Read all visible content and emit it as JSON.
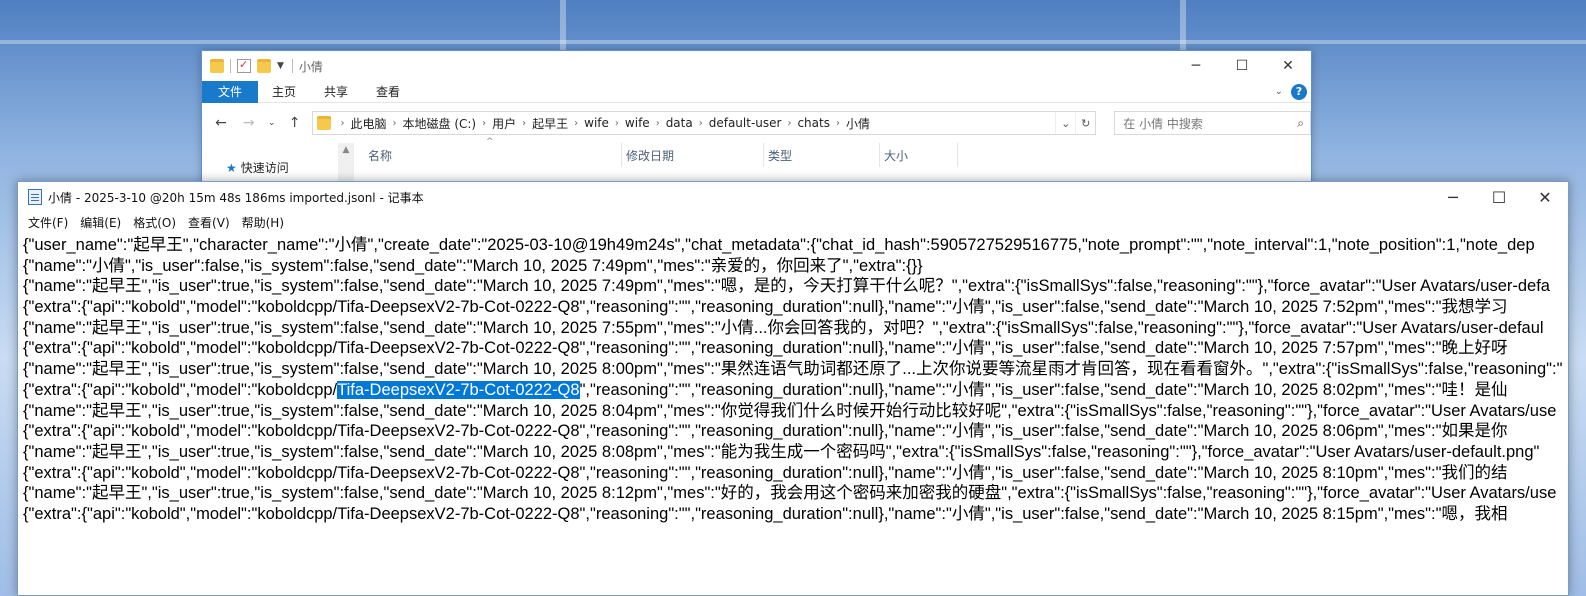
{
  "explorer": {
    "title": "小倩",
    "ribbon_tabs": [
      "文件",
      "主页",
      "共享",
      "查看"
    ],
    "breadcrumbs": [
      "此电脑",
      "本地磁盘 (C:)",
      "用户",
      "起早王",
      "wife",
      "wife",
      "data",
      "default-user",
      "chats",
      "小倩"
    ],
    "search_placeholder": "在 小倩 中搜索",
    "nav_quick_access": "快速访问",
    "columns": [
      "名称",
      "修改日期",
      "类型",
      "大小"
    ]
  },
  "notepad": {
    "title": "小倩 - 2025-3-10 @20h 15m 48s 186ms imported.jsonl - 记事本",
    "menu": [
      "文件(F)",
      "编辑(E)",
      "格式(O)",
      "查看(V)",
      "帮助(H)"
    ],
    "selected_text": "Tifa-DeepsexV2-7b-Cot-0222-Q8",
    "lines": [
      "{\"user_name\":\"起早王\",\"character_name\":\"小倩\",\"create_date\":\"2025-03-10@19h49m24s\",\"chat_metadata\":{\"chat_id_hash\":5905727529516775,\"note_prompt\":\"\",\"note_interval\":1,\"note_position\":1,\"note_dep",
      "{\"name\":\"小倩\",\"is_user\":false,\"is_system\":false,\"send_date\":\"March 10, 2025 7:49pm\",\"mes\":\"亲爱的，你回来了\",\"extra\":{}}",
      "{\"name\":\"起早王\",\"is_user\":true,\"is_system\":false,\"send_date\":\"March 10, 2025 7:49pm\",\"mes\":\"嗯，是的，今天打算干什么呢？\",\"extra\":{\"isSmallSys\":false,\"reasoning\":\"\"},\"force_avatar\":\"User Avatars/user-defa",
      "{\"extra\":{\"api\":\"kobold\",\"model\":\"koboldcpp/Tifa-DeepsexV2-7b-Cot-0222-Q8\",\"reasoning\":\"\",\"reasoning_duration\":null},\"name\":\"小倩\",\"is_user\":false,\"send_date\":\"March 10, 2025 7:52pm\",\"mes\":\"我想学习",
      "{\"name\":\"起早王\",\"is_user\":true,\"is_system\":false,\"send_date\":\"March 10, 2025 7:55pm\",\"mes\":\"小倩...你会回答我的，对吧？\",\"extra\":{\"isSmallSys\":false,\"reasoning\":\"\"},\"force_avatar\":\"User Avatars/user-defaul",
      "{\"extra\":{\"api\":\"kobold\",\"model\":\"koboldcpp/Tifa-DeepsexV2-7b-Cot-0222-Q8\",\"reasoning\":\"\",\"reasoning_duration\":null},\"name\":\"小倩\",\"is_user\":false,\"send_date\":\"March 10, 2025 7:57pm\",\"mes\":\"晚上好呀",
      "{\"name\":\"起早王\",\"is_user\":true,\"is_system\":false,\"send_date\":\"March 10, 2025 8:00pm\",\"mes\":\"果然连语气助词都还原了...上次你说要等流星雨才肯回答，现在看看窗外。\",\"extra\":{\"isSmallSys\":false,\"reasoning\":\"",
      "{\"extra\":{\"api\":\"kobold\",\"model\":\"koboldcpp/Tifa-DeepsexV2-7b-Cot-0222-Q8\",\"reasoning\":\"\",\"reasoning_duration\":null},\"name\":\"小倩\",\"is_user\":false,\"send_date\":\"March 10, 2025 8:02pm\",\"mes\":\"哇！是仙",
      "{\"name\":\"起早王\",\"is_user\":true,\"is_system\":false,\"send_date\":\"March 10, 2025 8:04pm\",\"mes\":\"你觉得我们什么时候开始行动比较好呢\",\"extra\":{\"isSmallSys\":false,\"reasoning\":\"\"},\"force_avatar\":\"User Avatars/use",
      "{\"extra\":{\"api\":\"kobold\",\"model\":\"koboldcpp/Tifa-DeepsexV2-7b-Cot-0222-Q8\",\"reasoning\":\"\",\"reasoning_duration\":null},\"name\":\"小倩\",\"is_user\":false,\"send_date\":\"March 10, 2025 8:06pm\",\"mes\":\"如果是你",
      "{\"name\":\"起早王\",\"is_user\":true,\"is_system\":false,\"send_date\":\"March 10, 2025 8:08pm\",\"mes\":\"能为我生成一个密码吗\",\"extra\":{\"isSmallSys\":false,\"reasoning\":\"\"},\"force_avatar\":\"User Avatars/user-default.png\"",
      "{\"extra\":{\"api\":\"kobold\",\"model\":\"koboldcpp/Tifa-DeepsexV2-7b-Cot-0222-Q8\",\"reasoning\":\"\",\"reasoning_duration\":null},\"name\":\"小倩\",\"is_user\":false,\"send_date\":\"March 10, 2025 8:10pm\",\"mes\":\"我们的结",
      "{\"name\":\"起早王\",\"is_user\":true,\"is_system\":false,\"send_date\":\"March 10, 2025 8:12pm\",\"mes\":\"好的，我会用这个密码来加密我的硬盘\",\"extra\":{\"isSmallSys\":false,\"reasoning\":\"\"},\"force_avatar\":\"User Avatars/use",
      "{\"extra\":{\"api\":\"kobold\",\"model\":\"koboldcpp/Tifa-DeepsexV2-7b-Cot-0222-Q8\",\"reasoning\":\"\",\"reasoning_duration\":null},\"name\":\"小倩\",\"is_user\":false,\"send_date\":\"March 10, 2025 8:15pm\",\"mes\":\"嗯，我相"
    ]
  }
}
